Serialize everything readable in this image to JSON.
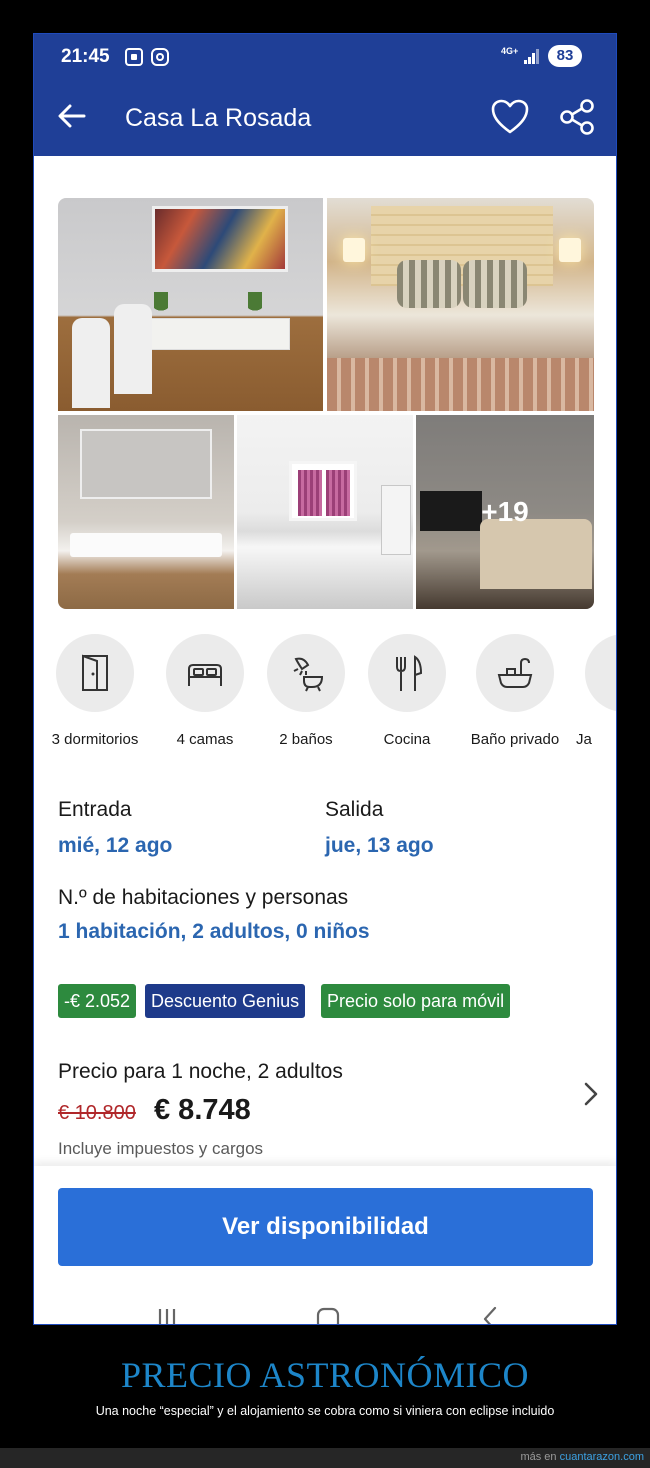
{
  "status_bar": {
    "time": "21:45",
    "network": "4G+",
    "battery": "83"
  },
  "app_bar": {
    "title": "Casa La Rosada"
  },
  "gallery": {
    "more_photos_label": "+19"
  },
  "amenities": [
    {
      "label": "3 dormitorios",
      "icon": "door-icon"
    },
    {
      "label": "4 camas",
      "icon": "bed-icon"
    },
    {
      "label": "2 baños",
      "icon": "shower-icon"
    },
    {
      "label": "Cocina",
      "icon": "cutlery-icon"
    },
    {
      "label": "Baño privado",
      "icon": "bathtub-icon"
    },
    {
      "label": "Ja",
      "icon": "partial-icon"
    }
  ],
  "dates": {
    "checkin_label": "Entrada",
    "checkin_value": "mié, 12 ago",
    "checkout_label": "Salida",
    "checkout_value": "jue, 13 ago"
  },
  "rooms": {
    "label": "N.º de habitaciones y personas",
    "value": "1 habitación, 2 adultos, 0 niños"
  },
  "badges": {
    "discount": "-€ 2.052",
    "genius": "Descuento Genius",
    "mobile": "Precio solo para móvil"
  },
  "price": {
    "label": "Precio para 1 noche, 2 adultos",
    "old": "€ 10.800",
    "new": "€ 8.748",
    "note": "Incluye impuestos y cargos"
  },
  "cta": {
    "label": "Ver disponibilidad"
  },
  "caption": {
    "title": "PRECIO ASTRONÓMICO",
    "subtitle": "Una noche “especial” y el alojamiento se cobra como si viniera con eclipse incluido"
  },
  "footer": {
    "prefix": "más en",
    "link": "cuantarazon.com"
  },
  "colors": {
    "app_bar": "#1f3f97",
    "accent_blue": "#2b66b0",
    "cta": "#2a6fd8",
    "badge_green": "#2d8a3e",
    "badge_blue": "#1e3a8a",
    "strike_red": "#b0272a",
    "caption_blue": "#1d86c9"
  }
}
